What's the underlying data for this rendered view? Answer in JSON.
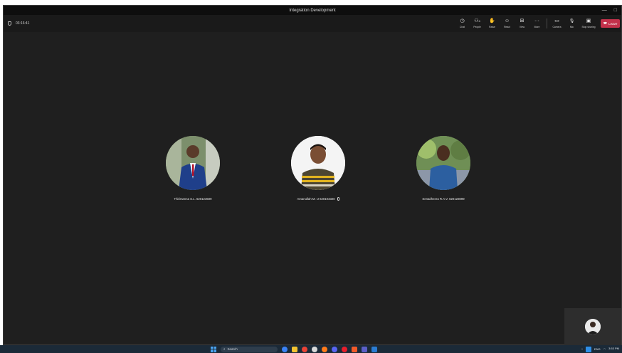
{
  "window": {
    "title": "Integration Development",
    "minimize_glyph": "—",
    "maximize_glyph": "□"
  },
  "toolbar": {
    "timer": "03:16:41",
    "tools": [
      {
        "label": "Chat",
        "icon": "chat-icon",
        "glyph": "◷"
      },
      {
        "label": "People",
        "icon": "people-icon",
        "glyph": "⚇",
        "count": "4"
      },
      {
        "label": "Raise",
        "icon": "raise-hand-icon",
        "glyph": "✋"
      },
      {
        "label": "React",
        "icon": "react-icon",
        "glyph": "☺"
      },
      {
        "label": "View",
        "icon": "view-icon",
        "glyph": "⊞"
      },
      {
        "label": "More",
        "icon": "more-icon",
        "glyph": "···"
      },
      {
        "label": "Camera",
        "icon": "camera-icon",
        "glyph": "▭"
      },
      {
        "label": "Mic",
        "icon": "mic-icon",
        "glyph": "🎙"
      },
      {
        "label": "Stop sharing",
        "icon": "share-icon",
        "glyph": "▣"
      }
    ],
    "leave_label": "Leave"
  },
  "participants": [
    {
      "name": "Thirimanna S.L. 620123509",
      "muted": false,
      "avatar": "avatar-suit-red-tie"
    },
    {
      "name": "Amanullah M. U 620103320",
      "muted": true,
      "avatar": "avatar-striped-shirt"
    },
    {
      "name": "Senadheera R.A.V. 620123099",
      "muted": false,
      "avatar": "avatar-blue-shirt"
    }
  ],
  "taskbar": {
    "search_placeholder": "Search",
    "tray_lang": "ENG",
    "clock_time": "3:53 PM",
    "clock_date": ""
  },
  "colors": {
    "leave": "#c4314b",
    "window_bg": "#1f1f1f",
    "taskbar_bg": "#1b2a38"
  }
}
